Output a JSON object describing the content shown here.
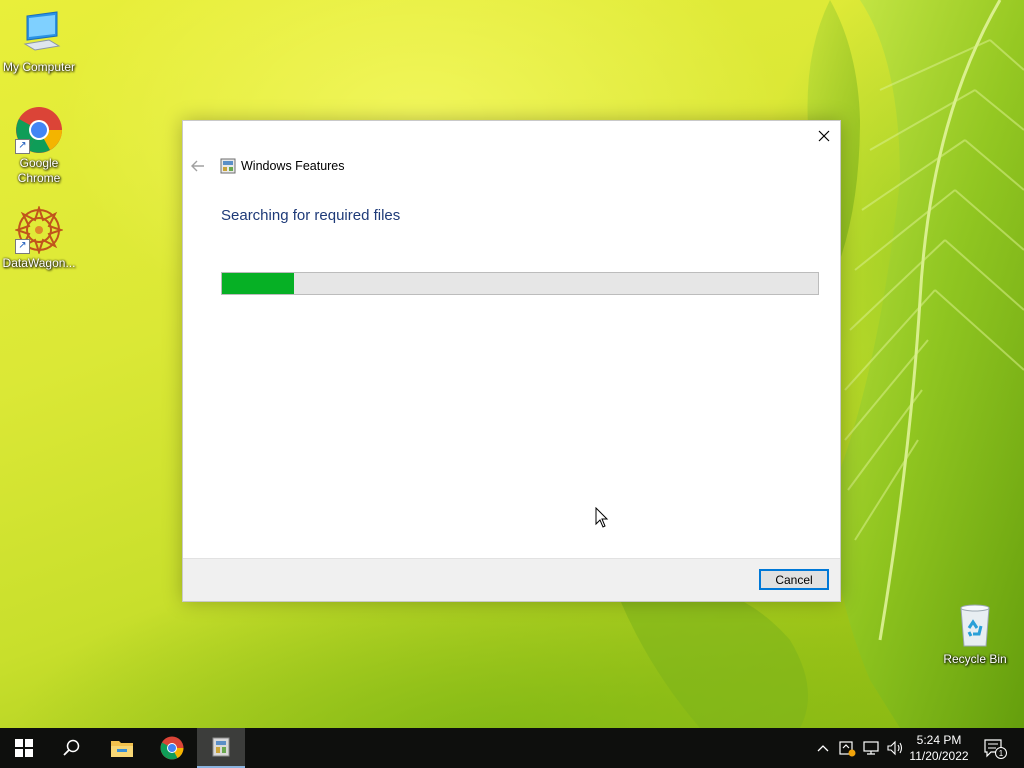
{
  "desktop": {
    "icons": [
      {
        "label": "My Computer"
      },
      {
        "label": "Google Chrome"
      },
      {
        "label": "DataWagon..."
      },
      {
        "label": "Recycle Bin"
      }
    ]
  },
  "dialog": {
    "title": "Windows Features",
    "heading": "Searching for required files",
    "progress_percent": 12,
    "cancel_label": "Cancel"
  },
  "taskbar": {
    "apps": [
      "start-icon",
      "search-icon",
      "file-explorer-icon",
      "chrome-icon",
      "windows-features-icon"
    ],
    "time": "5:24 PM",
    "date": "11/20/2022",
    "notification_count": "1"
  },
  "colors": {
    "progress_fill": "#06b025",
    "heading": "#1e3a78",
    "taskbar": "#0e0f0d"
  }
}
